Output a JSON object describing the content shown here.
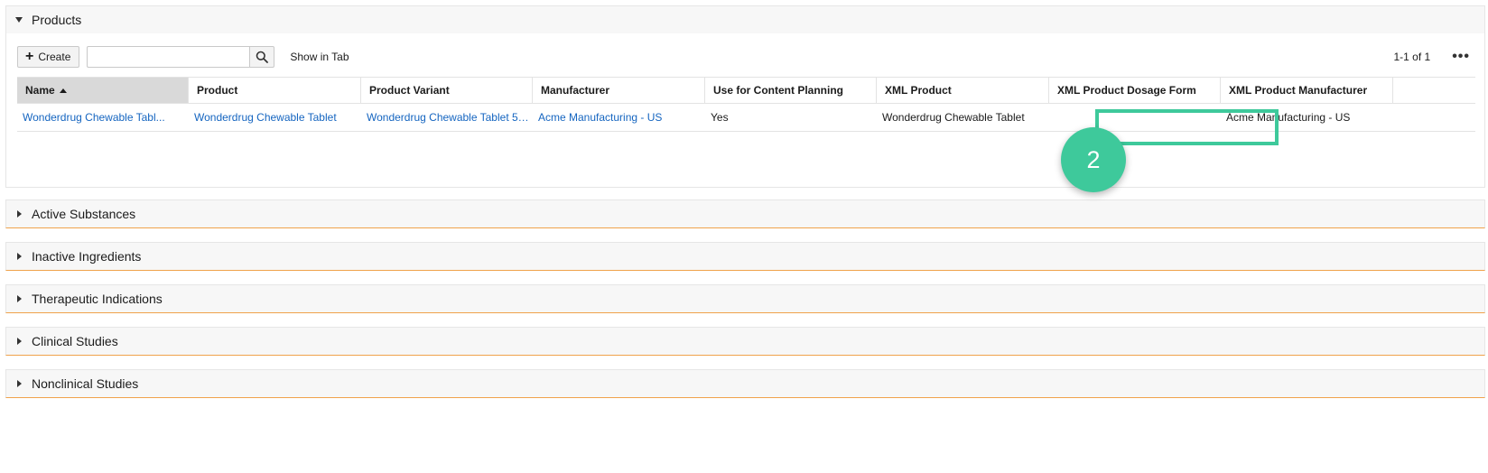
{
  "sections": [
    {
      "id": "products",
      "title": "Products",
      "expanded": true
    },
    {
      "id": "active-substances",
      "title": "Active Substances",
      "expanded": false
    },
    {
      "id": "inactive-ingredients",
      "title": "Inactive Ingredients",
      "expanded": false
    },
    {
      "id": "therapeutic-indications",
      "title": "Therapeutic Indications",
      "expanded": false
    },
    {
      "id": "clinical-studies",
      "title": "Clinical Studies",
      "expanded": false
    },
    {
      "id": "nonclinical-studies",
      "title": "Nonclinical Studies",
      "expanded": false
    }
  ],
  "toolbar": {
    "create_label": "Create",
    "search_value": "",
    "search_placeholder": "",
    "show_in_tab_label": "Show in Tab",
    "pager_text": "1-1 of 1",
    "more_label": "•••"
  },
  "grid": {
    "columns": [
      {
        "label": "Name",
        "sorted": "asc"
      },
      {
        "label": "Product"
      },
      {
        "label": "Product Variant"
      },
      {
        "label": "Manufacturer"
      },
      {
        "label": "Use for Content Planning"
      },
      {
        "label": "XML Product"
      },
      {
        "label": "XML Product Dosage Form"
      },
      {
        "label": "XML Product Manufacturer"
      }
    ],
    "rows": [
      [
        {
          "text": "Wonderdrug Chewable Tabl...",
          "link": true
        },
        {
          "text": "Wonderdrug Chewable Tablet",
          "link": true
        },
        {
          "text": "Wonderdrug Chewable Tablet 50...",
          "link": true
        },
        {
          "text": "Acme Manufacturing - US",
          "link": true
        },
        {
          "text": "Yes",
          "link": false
        },
        {
          "text": "Wonderdrug Chewable Tablet",
          "link": false
        },
        {
          "text": "",
          "link": false
        },
        {
          "text": "Acme Manufacturing - US",
          "link": false
        }
      ]
    ]
  },
  "annotation": {
    "step_number": "2",
    "color": "#3ec99b"
  },
  "colors": {
    "accent_border": "#f0a24b",
    "link": "#1565c0",
    "sorted_header_bg": "#d9d9d9"
  }
}
